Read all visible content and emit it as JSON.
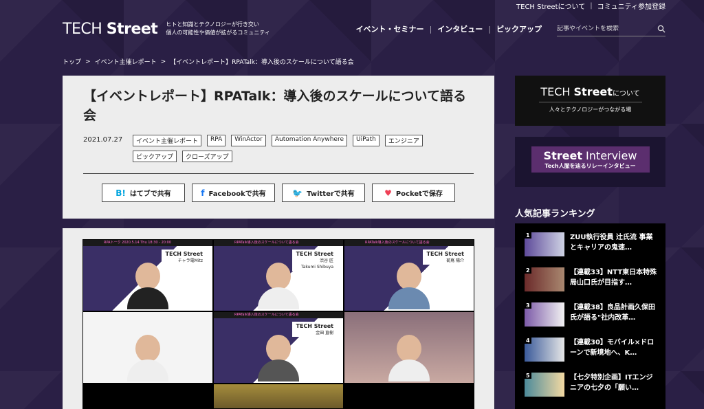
{
  "topbar": {
    "about": "TECH Streetについて",
    "separator": "|",
    "join": "コミュニティ参加登録"
  },
  "header": {
    "logo_light": "TECH ",
    "logo_bold": "Street",
    "tagline_line1": "ヒトと知識とテクノロジーが行き交い",
    "tagline_line2": "個人の可能性や価値が拡がるコミュニティ",
    "nav": [
      "イベント・セミナー",
      "インタビュー",
      "ピックアップ"
    ],
    "nav_separator": "|",
    "search_placeholder": "記事やイベントを検索"
  },
  "breadcrumb": {
    "items": [
      "トップ",
      "イベント主催レポート",
      "【イベントレポート】RPATalk：導入後のスケールについて語る会"
    ],
    "arrow": ">"
  },
  "article": {
    "title": "【イベントレポート】RPATalk：導入後のスケールについて語る会",
    "date": "2021.07.27",
    "tags": [
      "イベント主催レポート",
      "RPA",
      "WinActor",
      "Automation Anywhere",
      "UiPath",
      "エンジニア",
      "ピックアップ",
      "クローズアップ"
    ],
    "share": [
      {
        "icon": "B!",
        "label": "はてブで共有",
        "color": "#00a4de"
      },
      {
        "icon": "f",
        "label": "Facebookで共有",
        "color": "#1877f2"
      },
      {
        "icon": "🐦",
        "label": "Twitterで共有",
        "color": "#1da1f2"
      },
      {
        "icon": "♥",
        "label": "Pocketで保存",
        "color": "#ef4056"
      }
    ]
  },
  "video": {
    "strip_left": "RPAトーク 2020.5.14 Thu 18:30 - 20:00",
    "strip_mid": "RPATalk導入後のスケールについて語る会",
    "nameplates": [
      {
        "brand": "TECH Street",
        "name": "チャラ電Mitz"
      },
      {
        "brand": "TECH Street",
        "name": "渋谷 匠",
        "sub": "Takumi Shibuya"
      },
      {
        "brand": "TECH Street",
        "name": "菊嶌 陽介"
      },
      {
        "brand": "TECH Street",
        "name": "金田 直樹"
      }
    ]
  },
  "sidebar": {
    "banner1": {
      "light": "TECH ",
      "bold": "Street",
      "small": "について",
      "sub": "人々とテクノロジーがつながる場"
    },
    "banner2": {
      "bold": "Street",
      "light": " Interview",
      "sub": "Tech人脈を辿るリレーインタビュー"
    },
    "ranking_title": "人気記事ランキング",
    "ranking": [
      {
        "num": "1",
        "text": "ZUU執行役員 辻氏流 事業とキャリアの鬼速…"
      },
      {
        "num": "2",
        "text": "【連載33】NTT東日本特殊局山口氏が目指す…"
      },
      {
        "num": "3",
        "text": "【連載38】良品計画久保田氏が語る\"社内改革…"
      },
      {
        "num": "4",
        "text": "【連載30】モバイル×ドローンで新境地へ、K…"
      },
      {
        "num": "5",
        "text": "【七夕特別企画】ITエンジニアの七夕の「願い…"
      }
    ]
  },
  "colors": {
    "background": "#2a1f45",
    "card": "#ededed",
    "accent": "#5b2e6e"
  }
}
